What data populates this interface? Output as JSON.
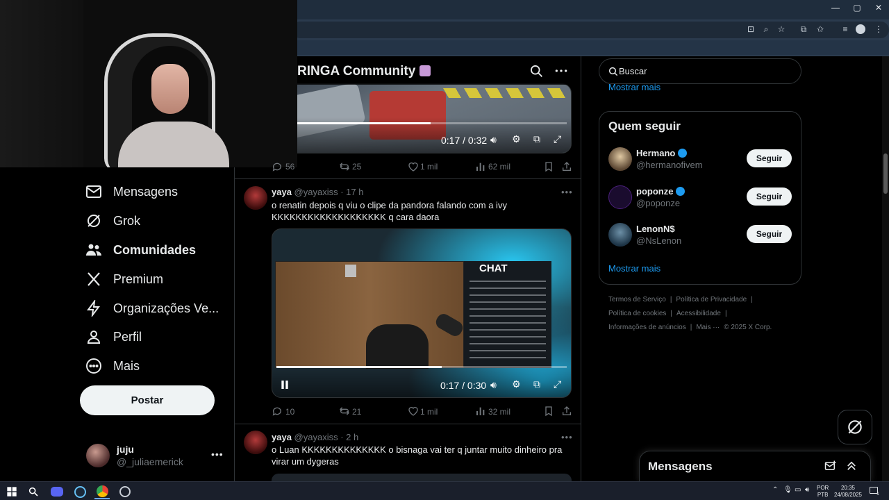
{
  "browser": {
    "window_controls": [
      "—",
      "▢",
      "✕"
    ]
  },
  "nav": {
    "items": [
      {
        "label": "Mensagens",
        "icon": "envelope-icon"
      },
      {
        "label": "Grok",
        "icon": "grok-icon"
      },
      {
        "label": "Comunidades",
        "icon": "people-icon"
      },
      {
        "label": "Premium",
        "icon": "x-logo-icon"
      },
      {
        "label": "Organizações Ve...",
        "icon": "lightning-icon"
      },
      {
        "label": "Perfil",
        "icon": "person-icon"
      },
      {
        "label": "Mais",
        "icon": "more-circle-icon"
      }
    ],
    "post_label": "Postar",
    "account": {
      "name": "juju",
      "handle": "@_juliaemerick"
    }
  },
  "community": {
    "title": "RINGA Community"
  },
  "tweet0": {
    "video_time": "0:17 / 0:32",
    "video_progress": 0.53,
    "replies": "56",
    "retweets": "25",
    "likes": "1 mil",
    "views": "62 mil"
  },
  "tweet1": {
    "name": "yaya",
    "handle_time": "@yayaxiss · 17 h",
    "text": "o renatin depois q viu o clipe da pandora falando com a ivy KKKKKKKKKKKKKKKKKKK q cara daora",
    "video_time": "0:17 / 0:30",
    "video_progress": 0.57,
    "chat_title": "CHAT",
    "replies": "10",
    "retweets": "21",
    "likes": "1 mil",
    "views": "32 mil"
  },
  "tweet2": {
    "name": "yaya",
    "handle_time": "@yayaxiss · 2 h",
    "text": "o Luan KKKKKKKKKKKKKK o bisnaga vai ter q juntar muito dinheiro pra virar um dygeras"
  },
  "right": {
    "search_placeholder": "Buscar",
    "show_more_top": "Mostrar mais",
    "who_to_follow": "Quem seguir",
    "follow_label": "Seguir",
    "suggestions": [
      {
        "name": "Hermano",
        "handle": "@hermanofivem",
        "verified": true
      },
      {
        "name": "poponze",
        "handle": "@poponze",
        "verified": true
      },
      {
        "name": "LenonN$",
        "handle": "@NsLenon",
        "verified": false
      }
    ],
    "show_more": "Mostrar mais",
    "footer_row1": [
      "Termos de Serviço",
      "|",
      "Política de Privacidade",
      "|"
    ],
    "footer_row2": [
      "Política de cookies",
      "|",
      "Acessibilidade",
      "|"
    ],
    "footer_row3": [
      "Informações de anúncios",
      "|",
      "Mais ···",
      "© 2025 X Corp."
    ]
  },
  "messages_dock": {
    "title": "Mensagens"
  },
  "taskbar": {
    "lang_top": "POR",
    "lang_bottom": "PTB",
    "time": "20:35",
    "date": "24/08/2025",
    "notification_count": "1"
  },
  "colors": {
    "accent": "#1d9bf0",
    "background": "#000000",
    "border": "#2f3336",
    "muted": "#71767b"
  }
}
